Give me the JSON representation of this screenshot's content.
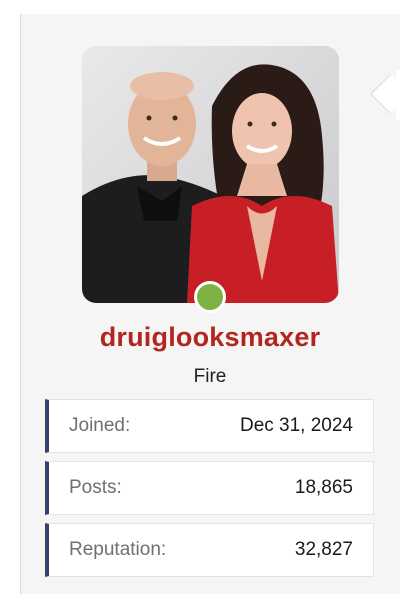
{
  "user": {
    "username": "druiglooksmaxer",
    "title": "Fire",
    "online_status": "online",
    "colors": {
      "username": "#b3261e",
      "online": "#7cb342",
      "stat_accent": "#35406b"
    }
  },
  "stats": [
    {
      "label": "Joined:",
      "value": "Dec 31, 2024"
    },
    {
      "label": "Posts:",
      "value": "18,865"
    },
    {
      "label": "Reputation:",
      "value": "32,827"
    }
  ]
}
